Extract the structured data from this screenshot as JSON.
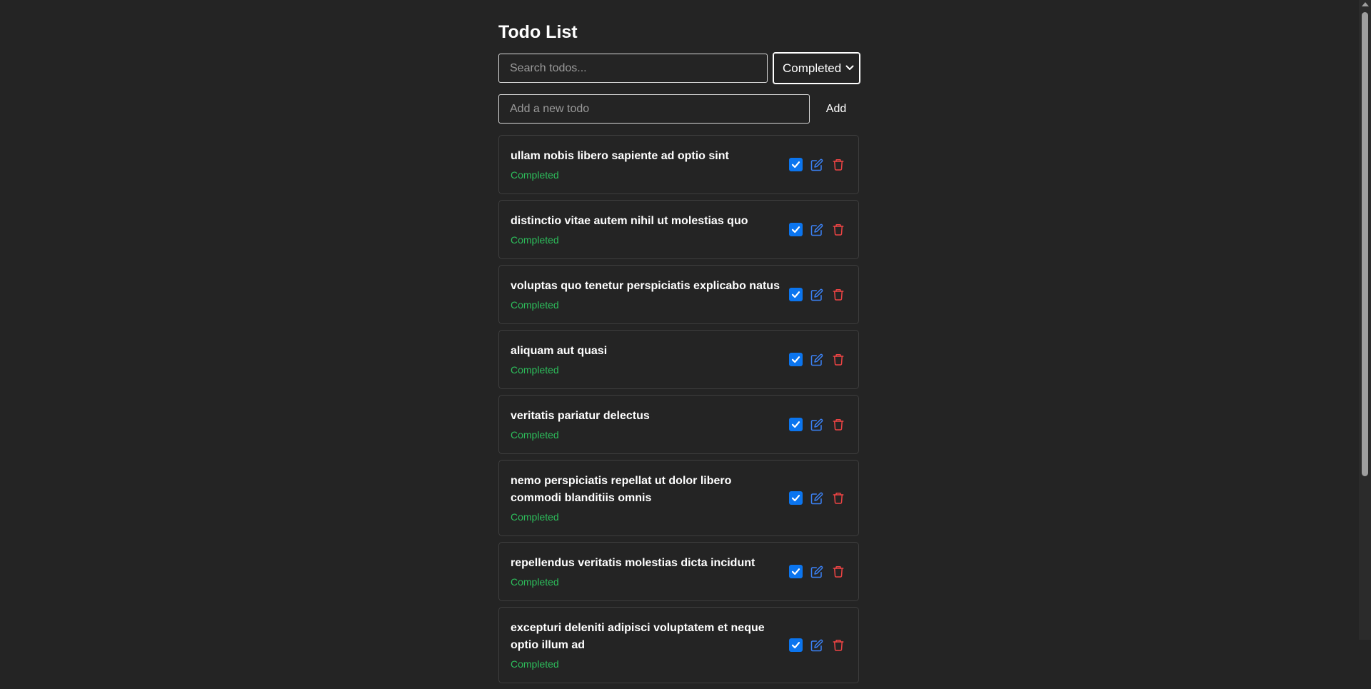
{
  "app": {
    "title": "Todo List"
  },
  "search": {
    "placeholder": "Search todos...",
    "value": ""
  },
  "filter": {
    "selected": "Completed",
    "icon": "chevron-down-icon"
  },
  "new_todo": {
    "placeholder": "Add a new todo",
    "value": "",
    "add_label": "Add"
  },
  "colors": {
    "background": "#242424",
    "completed_status": "#2dbd5b",
    "checkbox": "#0b75ef",
    "edit_icon": "#3b82f6",
    "delete_icon": "#ef4444"
  },
  "todos": [
    {
      "title": "ullam nobis libero sapiente ad optio sint",
      "status": "Completed",
      "checked": true
    },
    {
      "title": "distinctio vitae autem nihil ut molestias quo",
      "status": "Completed",
      "checked": true
    },
    {
      "title": "voluptas quo tenetur perspiciatis explicabo natus",
      "status": "Completed",
      "checked": true
    },
    {
      "title": "aliquam aut quasi",
      "status": "Completed",
      "checked": true
    },
    {
      "title": "veritatis pariatur delectus",
      "status": "Completed",
      "checked": true
    },
    {
      "title": "nemo perspiciatis repellat ut dolor libero commodi blanditiis omnis",
      "status": "Completed",
      "checked": true
    },
    {
      "title": "repellendus veritatis molestias dicta incidunt",
      "status": "Completed",
      "checked": true
    },
    {
      "title": "excepturi deleniti adipisci voluptatem et neque optio illum ad",
      "status": "Completed",
      "checked": true
    }
  ]
}
